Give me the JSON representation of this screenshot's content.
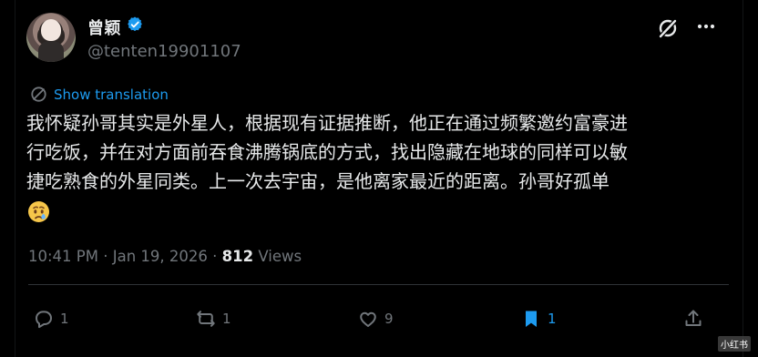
{
  "author": {
    "display_name": "曾颖",
    "handle": "@tenten19901107",
    "verified_icon": "verified-badge-icon"
  },
  "post": {
    "translate_label": "Show translation",
    "text_lines": [
      "我怀疑孙哥其实是外星人，根据现有证据推断，他正在通过频繁邀约富豪进",
      "行吃饭，并在对方面前吞食沸腾锅底的方式，找出隐藏在地球的同样可以敏",
      "捷吃熟食的外星同类。上一次去宇宙，是他离家最近的距离。孙哥好孤单"
    ],
    "emoji_name": "crying-face-emoji"
  },
  "meta": {
    "time": "10:41 PM",
    "separator": " · ",
    "date": "Jan 19, 2026",
    "views_count": "812",
    "views_label": " Views"
  },
  "actions": {
    "reply_count": "1",
    "repost_count": "1",
    "like_count": "9",
    "bookmark_count": "1"
  },
  "colors": {
    "background": "#000000",
    "text": "#e7e9ea",
    "secondary": "#71767b",
    "accent": "#1d9bf0"
  },
  "watermark": "小红书"
}
